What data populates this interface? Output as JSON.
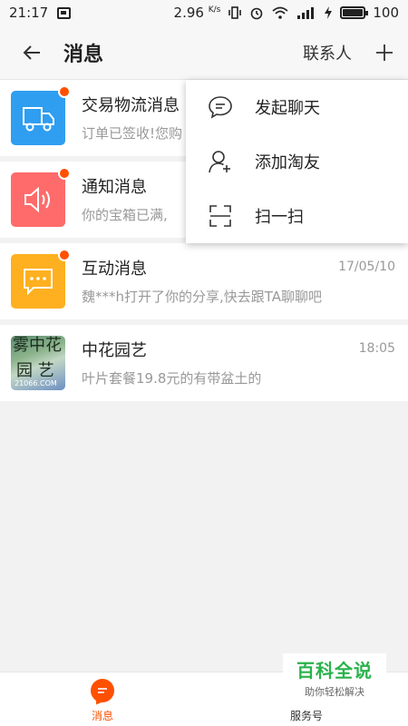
{
  "status_bar": {
    "time": "21:17",
    "speed": "2.96",
    "speed_unit": "K/s",
    "battery": "100"
  },
  "header": {
    "title": "消息",
    "contacts_label": "联系人",
    "back_icon": "back-arrow-icon",
    "plus_icon": "plus-icon"
  },
  "messages": [
    {
      "name": "交易物流消息",
      "preview": "订单已签收!您购",
      "time": "",
      "unread": true,
      "icon": "truck-icon",
      "color": "#2f9ef0"
    },
    {
      "name": "通知消息",
      "preview": "你的宝箱已满,",
      "time": "",
      "unread": true,
      "icon": "speaker-icon",
      "color": "#ff6b6b"
    },
    {
      "name": "互动消息",
      "preview": "魏***h打开了你的分享,快去跟TA聊聊吧",
      "time": "17/05/10",
      "unread": true,
      "icon": "chat-bubble-icon",
      "color": "#ffb020"
    },
    {
      "name": "中花园艺",
      "preview": "叶片套餐19.8元的有带盆土的",
      "time": "18:05",
      "unread": false,
      "icon": "shop-avatar",
      "avatar_text": "雾中花园艺"
    }
  ],
  "dropdown_menu": [
    {
      "label": "发起聊天",
      "icon": "chat-icon"
    },
    {
      "label": "添加淘友",
      "icon": "add-user-icon"
    },
    {
      "label": "扫一扫",
      "icon": "scan-icon"
    }
  ],
  "bottom_tabs": [
    {
      "label": "消息",
      "active": true,
      "icon": "message-icon"
    },
    {
      "label": "服务号",
      "active": false,
      "icon": "service-icon"
    }
  ],
  "watermark": {
    "main": "百科全说",
    "sub": "助你轻松解决"
  },
  "colors": {
    "accent": "#ff5000",
    "watermark_green": "#2bb24c"
  }
}
